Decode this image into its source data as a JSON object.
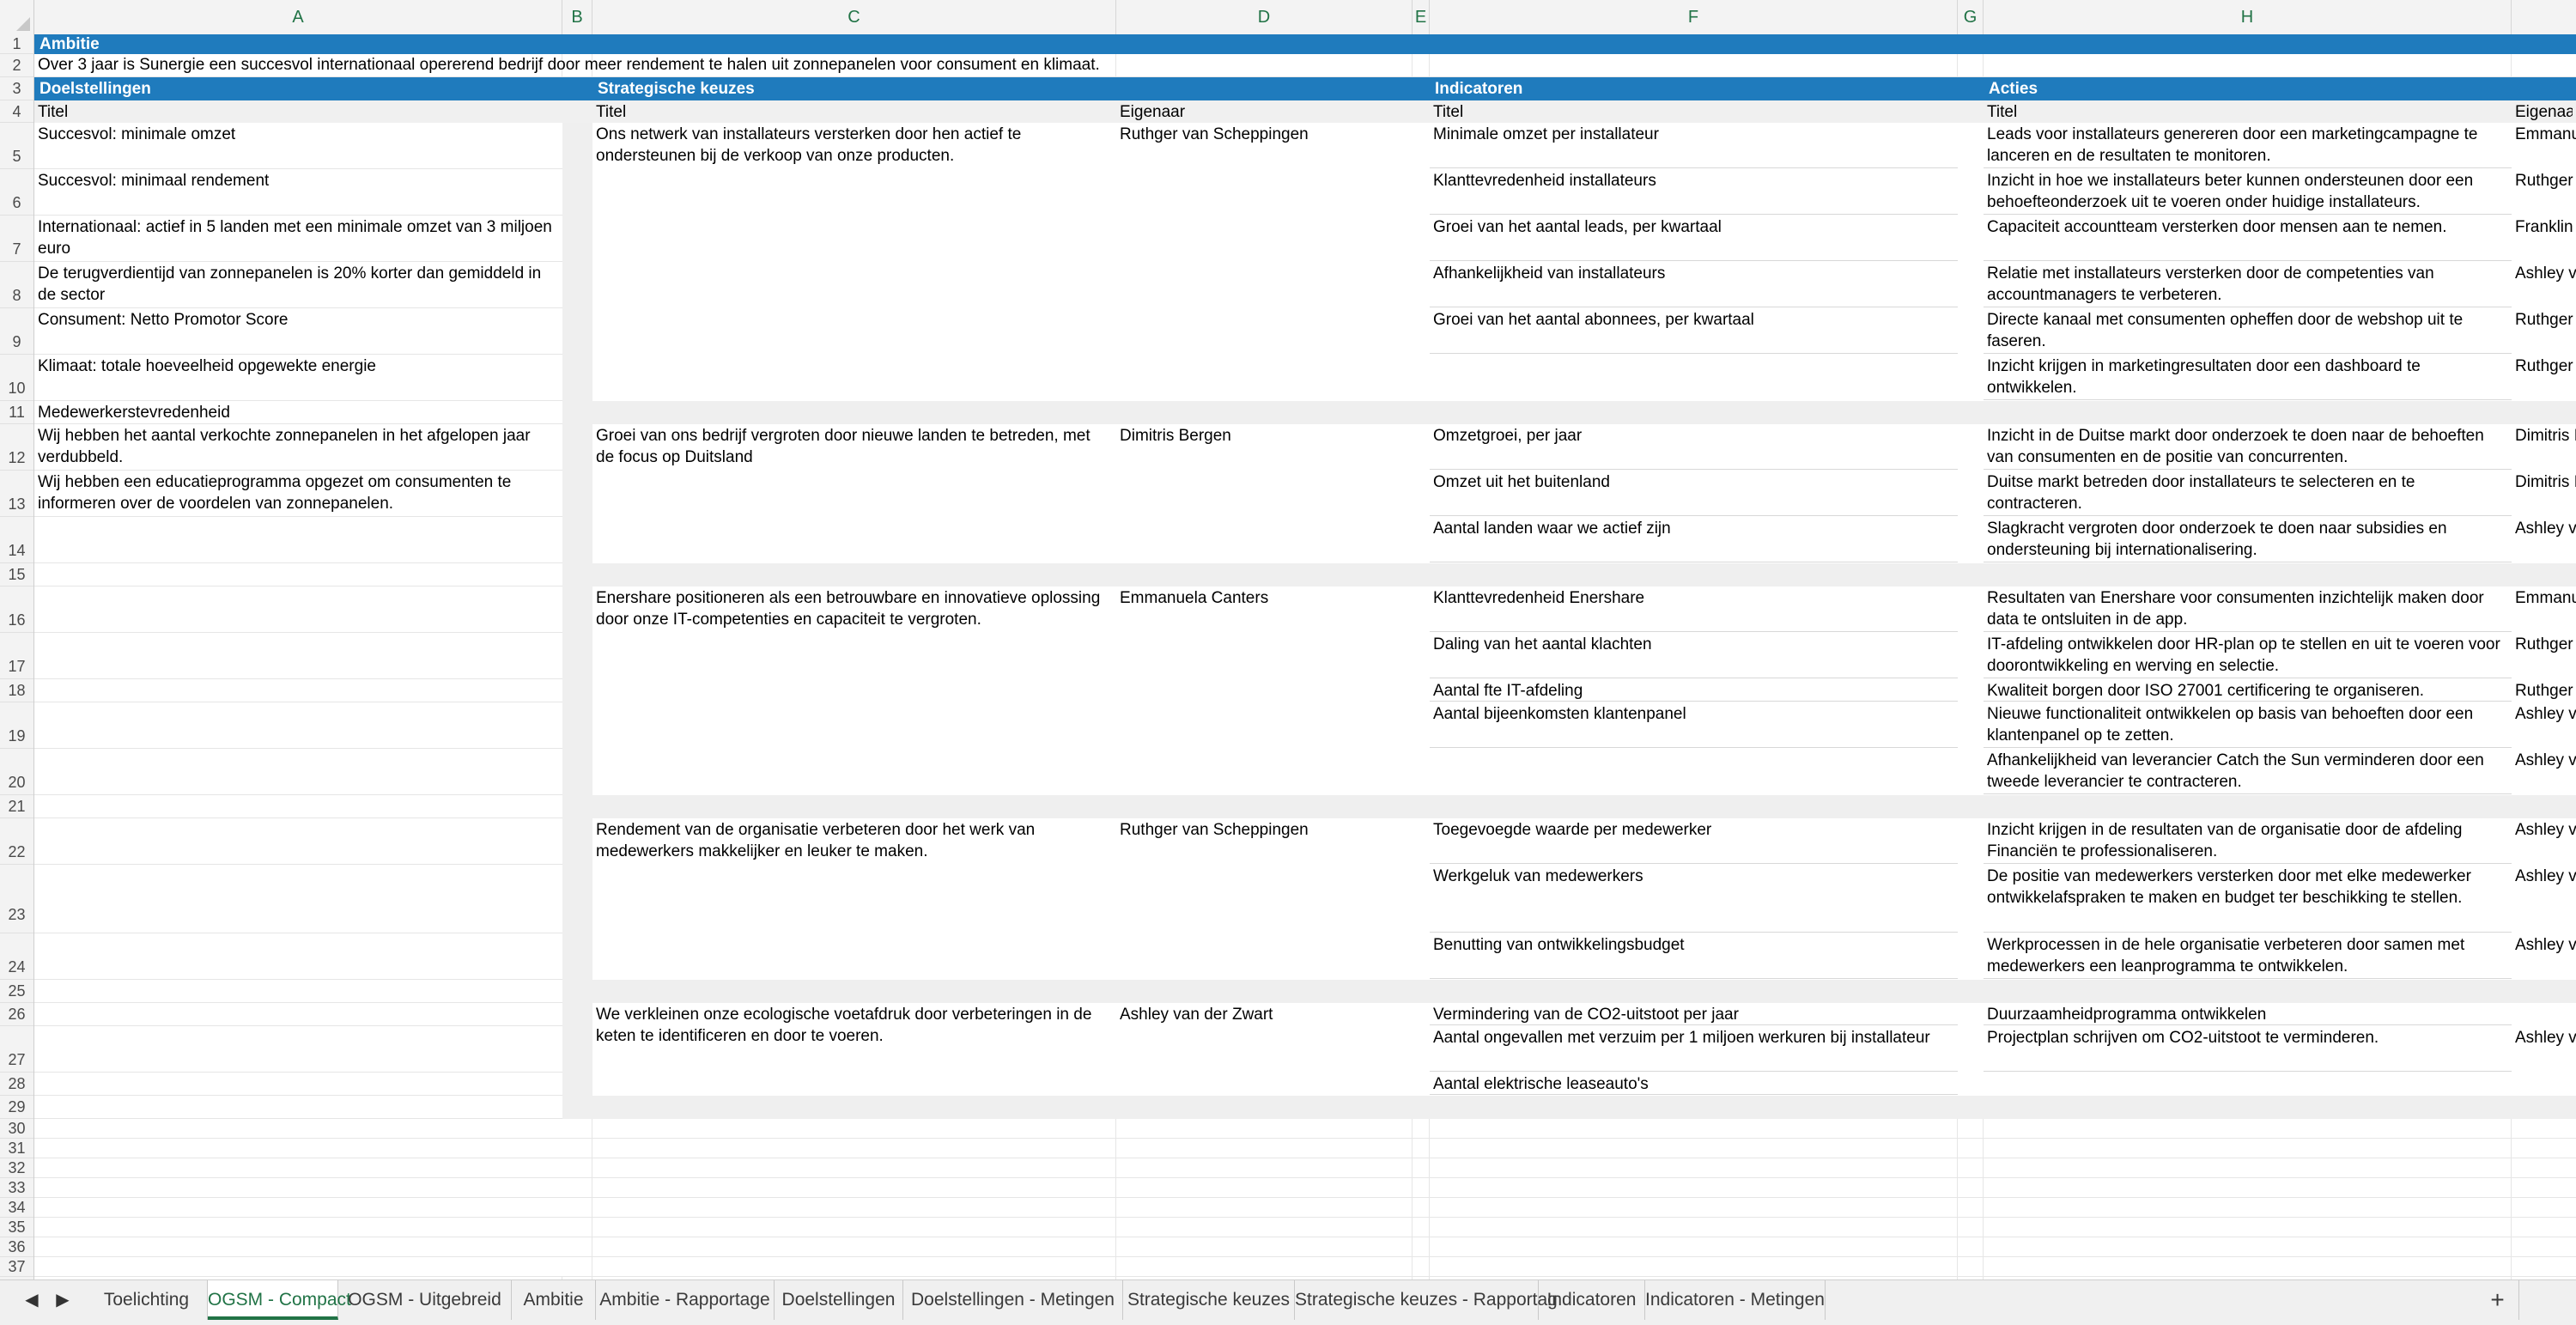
{
  "columns": [
    "A",
    "B",
    "C",
    "D",
    "E",
    "F",
    "G",
    "H"
  ],
  "rows": [
    "1",
    "2",
    "3",
    "4",
    "5",
    "6",
    "7",
    "8",
    "9",
    "10",
    "11",
    "12",
    "13",
    "14",
    "15",
    "16",
    "17",
    "18",
    "19",
    "20",
    "21",
    "22",
    "23",
    "24",
    "25",
    "26",
    "27",
    "28",
    "29",
    "30",
    "31",
    "32",
    "33",
    "34",
    "35",
    "36",
    "37"
  ],
  "ambition": {
    "header": "Ambitie",
    "text": "Over 3 jaar is Sunergie een succesvol internationaal opererend bedrijf door meer rendement te halen uit zonnepanelen voor consument en klimaat."
  },
  "sections": {
    "goals": "Doelstellingen",
    "strategies": "Strategische keuzes",
    "indicators": "Indicatoren",
    "actions": "Acties"
  },
  "subheaders": {
    "title_a": "Titel",
    "title_c": "Titel",
    "owner_d": "Eigenaar",
    "title_f": "Titel",
    "title_h": "Titel",
    "owner_i": "Eigenaar"
  },
  "goals": [
    "Succesvol: minimale omzet",
    "Succesvol: minimaal rendement",
    "Internationaal: actief in 5 landen met een minimale omzet van 3 miljoen euro",
    "De terugverdientijd van zonnepanelen is 20% korter dan gemiddeld in de sector",
    "Consument: Netto Promotor Score",
    "Klimaat: totale hoeveelheid opgewekte energie",
    "Medewerkerstevredenheid",
    "Wij hebben het aantal verkochte zonnepanelen in het afgelopen jaar verdubbeld.",
    "Wij hebben een educatieprogramma opgezet om consumenten te informeren over de voordelen van zonnepanelen."
  ],
  "strategies": [
    {
      "title": "Ons netwerk van installateurs versterken door hen actief te ondersteunen bij de verkoop van onze producten.",
      "owner": "Ruthger van Scheppingen"
    },
    {
      "title": "Groei van ons bedrijf vergroten door nieuwe landen te betreden, met de focus op Duitsland",
      "owner": "Dimitris Bergen"
    },
    {
      "title": "Enershare positioneren als een betrouwbare en innovatieve oplossing door onze IT-competenties en capaciteit te vergroten.",
      "owner": "Emmanuela Canters"
    },
    {
      "title": "Rendement van de organisatie verbeteren door het werk van medewerkers makkelijker en leuker te maken.",
      "owner": "Ruthger van Scheppingen"
    },
    {
      "title": "We verkleinen onze ecologische voetafdruk door verbeteringen in de keten te identificeren en door te voeren.",
      "owner": "Ashley van der Zwart"
    }
  ],
  "indicators": [
    "Minimale omzet per installateur",
    "Klanttevredenheid installateurs",
    "Groei van het aantal leads, per kwartaal",
    "Afhankelijkheid van installateurs",
    "Groei van het aantal abonnees, per kwartaal",
    "Omzetgroei, per jaar",
    "Omzet uit het buitenland",
    "Aantal landen waar we actief zijn",
    "Klanttevredenheid Enershare",
    "Daling van het aantal klachten",
    "Aantal fte IT-afdeling",
    "Aantal bijeenkomsten klantenpanel",
    "Toegevoegde waarde per medewerker",
    "Werkgeluk van medewerkers",
    "Benutting van ontwikkelingsbudget",
    "Vermindering van de CO2-uitstoot per jaar",
    "Aantal ongevallen met verzuim per 1 miljoen werkuren bij installateur",
    "Aantal elektrische leaseauto's"
  ],
  "actions": [
    {
      "title": "Leads voor installateurs genereren door een marketingcampagne te lanceren en de resultaten te monitoren.",
      "owner": "Emmanu"
    },
    {
      "title": "Inzicht in hoe we installateurs beter kunnen ondersteunen door een behoefteonderzoek uit te voeren onder huidige installateurs.",
      "owner": "Ruthger"
    },
    {
      "title": "Capaciteit accountteam versterken door mensen aan te nemen.",
      "owner": "Franklin"
    },
    {
      "title": "Relatie met installateurs versterken door de competenties van accountmanagers te verbeteren.",
      "owner": "Ashley v"
    },
    {
      "title": "Directe kanaal met consumenten opheffen door de webshop uit te faseren.",
      "owner": "Ruthger"
    },
    {
      "title": "Inzicht krijgen in marketingresultaten door een dashboard te ontwikkelen.",
      "owner": "Ruthger"
    },
    {
      "title": "Inzicht in de Duitse markt door onderzoek te doen naar de behoeften van consumenten en de positie van concurrenten.",
      "owner": "Dimitris I"
    },
    {
      "title": "Duitse markt betreden door installateurs te selecteren en te contracteren.",
      "owner": "Dimitris I"
    },
    {
      "title": "Slagkracht vergroten door onderzoek te doen naar subsidies en ondersteuning bij internationalisering.",
      "owner": "Ashley v"
    },
    {
      "title": "Resultaten van Enershare voor consumenten inzichtelijk maken door data te ontsluiten in de app.",
      "owner": "Emmanu"
    },
    {
      "title": "IT-afdeling ontwikkelen door HR-plan op te stellen en uit te voeren voor doorontwikkeling en werving en selectie.",
      "owner": "Ruthger"
    },
    {
      "title": "Kwaliteit borgen door ISO 27001 certificering te organiseren.",
      "owner": "Ruthger"
    },
    {
      "title": "Nieuwe functionaliteit ontwikkelen op basis van behoeften door een klantenpanel op te zetten.",
      "owner": "Ashley v"
    },
    {
      "title": "Afhankelijkheid van leverancier Catch the Sun verminderen door een tweede leverancier te contracteren.",
      "owner": "Ashley v"
    },
    {
      "title": "Inzicht krijgen in de resultaten van de organisatie door de afdeling Financiën te professionaliseren.",
      "owner": "Ashley v"
    },
    {
      "title": "De positie van medewerkers versterken door met elke medewerker ontwikkelafspraken te maken en budget ter beschikking te stellen.",
      "owner": "Ashley v"
    },
    {
      "title": "Werkprocessen in de hele organisatie verbeteren door samen met medewerkers een leanprogramma te ontwikkelen.",
      "owner": "Ashley v"
    },
    {
      "title": "Duurzaamheidprogramma ontwikkelen",
      "owner": ""
    },
    {
      "title": "Projectplan schrijven om CO2-uitstoot te verminderen.",
      "owner": "Ashley v"
    }
  ],
  "tabs": [
    {
      "label": "Toelichting",
      "active": false
    },
    {
      "label": "OGSM - Compact",
      "active": true
    },
    {
      "label": "OGSM - Uitgebreid",
      "active": false
    },
    {
      "label": "Ambitie",
      "active": false
    },
    {
      "label": "Ambitie - Rapportage",
      "active": false
    },
    {
      "label": "Doelstellingen",
      "active": false
    },
    {
      "label": "Doelstellingen - Metingen",
      "active": false
    },
    {
      "label": "Strategische keuzes",
      "active": false
    },
    {
      "label": "Strategische keuzes - Rapportag",
      "active": false
    },
    {
      "label": "Indicatoren",
      "active": false
    },
    {
      "label": "Indicatoren - Metingen",
      "active": false
    }
  ],
  "nav": {
    "prev": "◀",
    "next": "▶",
    "add": "+"
  },
  "colors": {
    "band": "#1f7bbd",
    "accent": "#217346",
    "panel": "#efefef"
  }
}
